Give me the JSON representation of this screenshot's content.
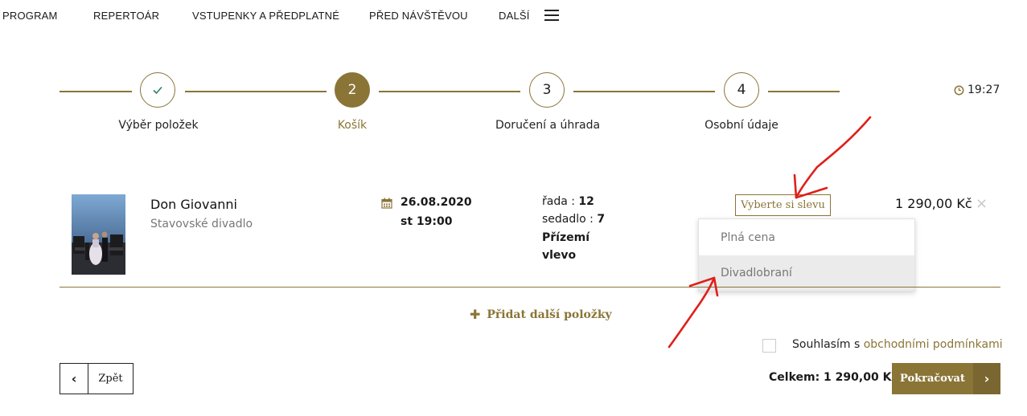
{
  "nav": {
    "items": [
      "PROGRAM",
      "REPERTOÁR",
      "VSTUPENKY A PŘEDPLATNÉ",
      "PŘED NÁVŠTĚVOU",
      "DALŠÍ"
    ]
  },
  "stepper": {
    "steps": [
      {
        "number": "",
        "label": "Výběr položek",
        "state": "done"
      },
      {
        "number": "2",
        "label": "Košík",
        "state": "active"
      },
      {
        "number": "3",
        "label": "Doručení a úhrada",
        "state": "pending"
      },
      {
        "number": "4",
        "label": "Osobní údaje",
        "state": "pending"
      }
    ],
    "timer": "19:27"
  },
  "item": {
    "title": "Don Giovanni",
    "venue": "Stavovské divadlo",
    "date": "26.08.2020",
    "time": "st 19:00",
    "row_label": "řada : ",
    "row_value": "12",
    "seat_label": "sedadlo : ",
    "seat_value": "7",
    "section_line1": "Přízemí",
    "section_line2": "vlevo",
    "discount_button": "Vyberte si slevu",
    "discount_options": [
      "Plná cena",
      "Divadlobraní"
    ],
    "price": "1 290,00 Kč",
    "remove_icon": "×"
  },
  "add_more": "Přidat další položky",
  "terms": {
    "prefix": "Souhlasím s ",
    "link": "obchodními podmínkami"
  },
  "footer": {
    "back_label": "Zpět",
    "total": "Celkem: 1 290,00 Kč",
    "continue_label": "Pokračovat"
  },
  "colors": {
    "accent": "#8a7537",
    "annotation": "#e0201b"
  }
}
